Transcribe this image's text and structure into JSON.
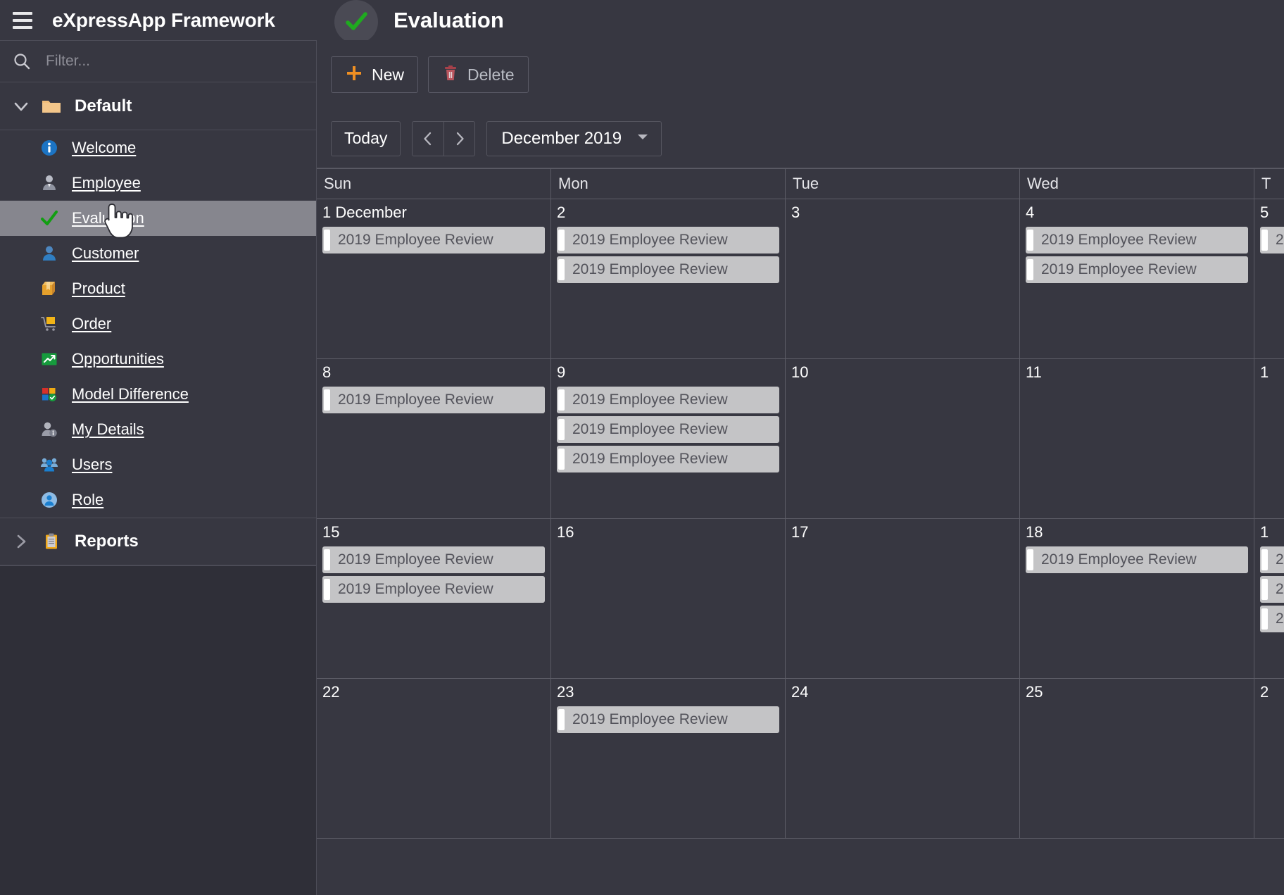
{
  "app": {
    "title": "eXpressApp Framework",
    "menu_icon": "hamburger-icon"
  },
  "view": {
    "title": "Evaluation",
    "icon": "green-check-icon"
  },
  "sidebar": {
    "filter": {
      "placeholder": "Filter...",
      "value": "",
      "icon": "search-icon"
    },
    "groups": [
      {
        "label": "Default",
        "icon": "folder-icon",
        "expanded": true,
        "chevron": "chevron-down-icon",
        "items": [
          {
            "label": "Welcome",
            "icon": "info-circle-icon",
            "selected": false
          },
          {
            "label": "Employee",
            "icon": "employee-icon",
            "selected": false
          },
          {
            "label": "Evaluation",
            "icon": "green-check-icon",
            "selected": true
          },
          {
            "label": "Customer",
            "icon": "person-icon",
            "selected": false
          },
          {
            "label": "Product",
            "icon": "box-icon",
            "selected": false
          },
          {
            "label": "Order",
            "icon": "cart-icon",
            "selected": false
          },
          {
            "label": "Opportunities",
            "icon": "trending-up-icon",
            "selected": false
          },
          {
            "label": "Model Difference",
            "icon": "model-diff-icon",
            "selected": false
          },
          {
            "label": "My Details",
            "icon": "person-info-icon",
            "selected": false
          },
          {
            "label": "Users",
            "icon": "users-icon",
            "selected": false
          },
          {
            "label": "Role",
            "icon": "role-icon",
            "selected": false
          }
        ]
      },
      {
        "label": "Reports",
        "icon": "clipboard-icon",
        "expanded": false,
        "chevron": "chevron-right-icon",
        "items": []
      }
    ]
  },
  "toolbar": {
    "new_label": "New",
    "new_icon": "plus-icon",
    "delete_label": "Delete",
    "delete_icon": "trash-icon"
  },
  "calendar_nav": {
    "today_label": "Today",
    "prev_icon": "chevron-left-icon",
    "next_icon": "chevron-right-icon",
    "period_label": "December 2019",
    "dropdown_icon": "caret-down-icon"
  },
  "calendar": {
    "weekday_headers": [
      "Sun",
      "Mon",
      "Tue",
      "Wed",
      "T"
    ],
    "appointment_title": "2019 Employee Review",
    "rows": [
      [
        {
          "daynum": "1 December",
          "appts": 1
        },
        {
          "daynum": "2",
          "appts": 2
        },
        {
          "daynum": "3",
          "appts": 0
        },
        {
          "daynum": "4",
          "appts": 2
        },
        {
          "daynum": "5",
          "appts": 1
        }
      ],
      [
        {
          "daynum": "8",
          "appts": 1
        },
        {
          "daynum": "9",
          "appts": 3
        },
        {
          "daynum": "10",
          "appts": 0
        },
        {
          "daynum": "11",
          "appts": 0
        },
        {
          "daynum": "1",
          "appts": 0
        }
      ],
      [
        {
          "daynum": "15",
          "appts": 2
        },
        {
          "daynum": "16",
          "appts": 0
        },
        {
          "daynum": "17",
          "appts": 0
        },
        {
          "daynum": "18",
          "appts": 1
        },
        {
          "daynum": "1",
          "appts": 3
        }
      ],
      [
        {
          "daynum": "22",
          "appts": 0
        },
        {
          "daynum": "23",
          "appts": 1
        },
        {
          "daynum": "24",
          "appts": 0
        },
        {
          "daynum": "25",
          "appts": 0
        },
        {
          "daynum": "2",
          "appts": 0
        }
      ]
    ]
  },
  "colors": {
    "background": "#373741",
    "sidebar_selected": "#86868e",
    "accent_green": "#21a521",
    "accent_orange": "#e8921e",
    "accent_blue": "#1e79c8",
    "grid_line": "#5c5c66",
    "appointment_bg": "#c4c4c6"
  }
}
